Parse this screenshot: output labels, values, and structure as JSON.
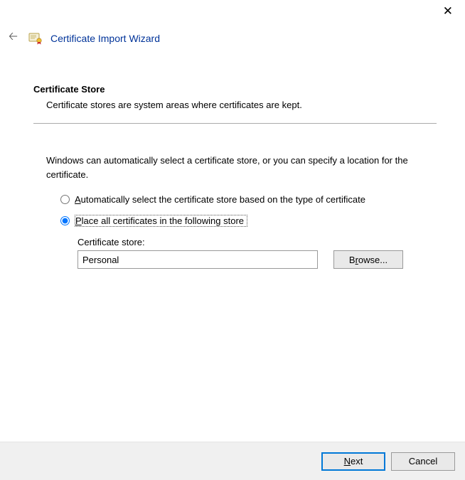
{
  "window": {
    "title": "Certificate Import Wizard"
  },
  "section": {
    "title": "Certificate Store",
    "description": "Certificate stores are system areas where certificates are kept."
  },
  "body": {
    "intro": "Windows can automatically select a certificate store, or you can specify a location for the certificate."
  },
  "radio": {
    "auto_prefix": "A",
    "auto_rest": "utomatically select the certificate store based on the type of certificate",
    "place_prefix": "P",
    "place_rest": "lace all certificates in the following store"
  },
  "store": {
    "label": "Certificate store:",
    "value": "Personal",
    "browse_prefix": "B",
    "browse_char": "r",
    "browse_rest": "owse..."
  },
  "footer": {
    "next_char": "N",
    "next_rest": "ext",
    "cancel": "Cancel"
  }
}
